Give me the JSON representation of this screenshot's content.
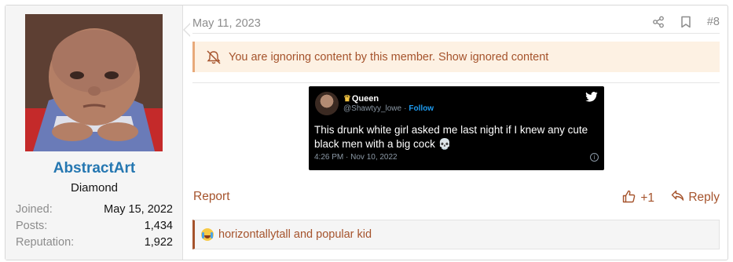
{
  "user": {
    "username": "AbstractArt",
    "title": "Diamond",
    "stats": [
      {
        "label": "Joined:",
        "value": "May 15, 2022"
      },
      {
        "label": "Posts:",
        "value": "1,434"
      },
      {
        "label": "Reputation:",
        "value": "1,922"
      }
    ]
  },
  "post": {
    "date": "May 11, 2023",
    "number": "#8",
    "ignored_text": "You are ignoring content by this member.",
    "ignored_link": "Show ignored content",
    "report_label": "Report",
    "like_label": "+1",
    "reply_label": "Reply",
    "reactions_text": "horizontallytall and popular kid"
  },
  "tweet": {
    "name": "Queen",
    "handle": "@Shawtyy_lowe",
    "separator": "·",
    "follow": "Follow",
    "text": "This drunk white girl asked me last night if I knew any cute black men with a big cock 💀",
    "timestamp": "4:26 PM · Nov 10, 2022",
    "info_glyph": "i"
  },
  "icons": {
    "share": "share-icon",
    "bookmark": "bookmark-icon",
    "ignore": "mute-icon",
    "like": "thumbs-up-icon",
    "reply": "reply-icon",
    "bird": "twitter-bird-icon",
    "crown": "crown-icon"
  },
  "colors": {
    "accent": "#a5532c",
    "username": "#2577b1",
    "ignored_bg": "#fdf1e3",
    "tweet_bg": "#000000",
    "twitter_blue": "#1d9bf0"
  }
}
